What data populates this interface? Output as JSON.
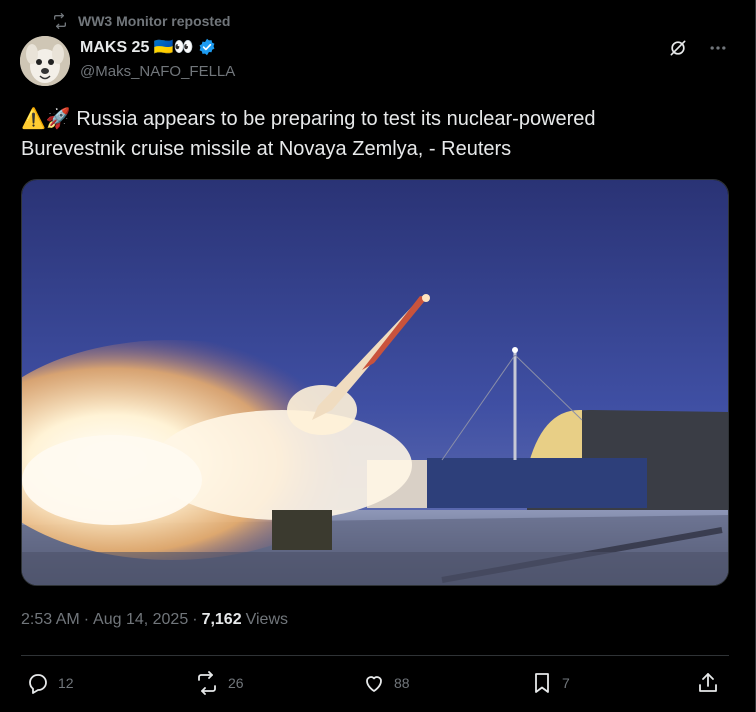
{
  "repost": {
    "text": "WW3 Monitor reposted"
  },
  "author": {
    "display_name": "MAKS 25 🇺🇦👀",
    "handle": "@Maks_NAFO_FELLA"
  },
  "tweet": {
    "text_line1": "⚠️🚀 Russia appears to be preparing to test its nuclear-powered",
    "text_line2": "Burevestnik cruise missile at Novaya Zemlya, - Reuters"
  },
  "meta": {
    "time": "2:53 AM",
    "separator": "·",
    "date": "Aug 14, 2025",
    "views_count": "7,162",
    "views_label": "Views"
  },
  "actions": {
    "replies": "12",
    "reposts": "26",
    "likes": "88",
    "bookmarks": "7"
  },
  "colors": {
    "background": "#000000",
    "text": "#e7e9ea",
    "secondary": "#71767b",
    "verified": "#1d9bf0",
    "divider": "#2f3336"
  },
  "icons": [
    "repost-icon",
    "verified-badge-icon",
    "grok-icon",
    "more-icon",
    "reply-icon",
    "repost-icon",
    "like-icon",
    "bookmark-icon",
    "share-icon"
  ]
}
